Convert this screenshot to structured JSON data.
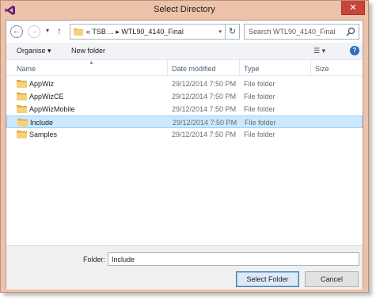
{
  "window": {
    "title": "Select Directory",
    "close_label": "✕"
  },
  "navigation": {
    "back_glyph": "←",
    "forward_glyph": "→",
    "recent_glyph": "▾",
    "up_glyph": "↑",
    "address_text": "«  TSB ...  ▸  WTL90_4140_Final",
    "address_chevron": "▾",
    "refresh_glyph": "↻",
    "search_placeholder": "Search WTL90_4140_Final"
  },
  "toolbar": {
    "organise_label": "Organise ▾",
    "new_folder_label": "New folder",
    "view_label": "☰ ▾",
    "help_label": "?"
  },
  "columns": {
    "name": "Name",
    "date": "Date modified",
    "type": "Type",
    "size": "Size"
  },
  "files": [
    {
      "name": "AppWiz",
      "date": "29/12/2014 7:50 PM",
      "type": "File folder"
    },
    {
      "name": "AppWizCE",
      "date": "29/12/2014 7:50 PM",
      "type": "File folder"
    },
    {
      "name": "AppWizMobile",
      "date": "29/12/2014 7:50 PM",
      "type": "File folder"
    },
    {
      "name": "Include",
      "date": "29/12/2014 7:50 PM",
      "type": "File folder"
    },
    {
      "name": "Samples",
      "date": "29/12/2014 7:50 PM",
      "type": "File folder"
    }
  ],
  "selected_index": 3,
  "footer": {
    "folder_label": "Folder:",
    "folder_value": "Include",
    "select_button": "Select Folder",
    "cancel_button": "Cancel"
  },
  "colors": {
    "window_frame": "#ecc2aa",
    "close_button": "#c7463b",
    "selection": "#cce8ff",
    "folder_icon": "#e8b94a",
    "app_icon": "#68217a"
  }
}
